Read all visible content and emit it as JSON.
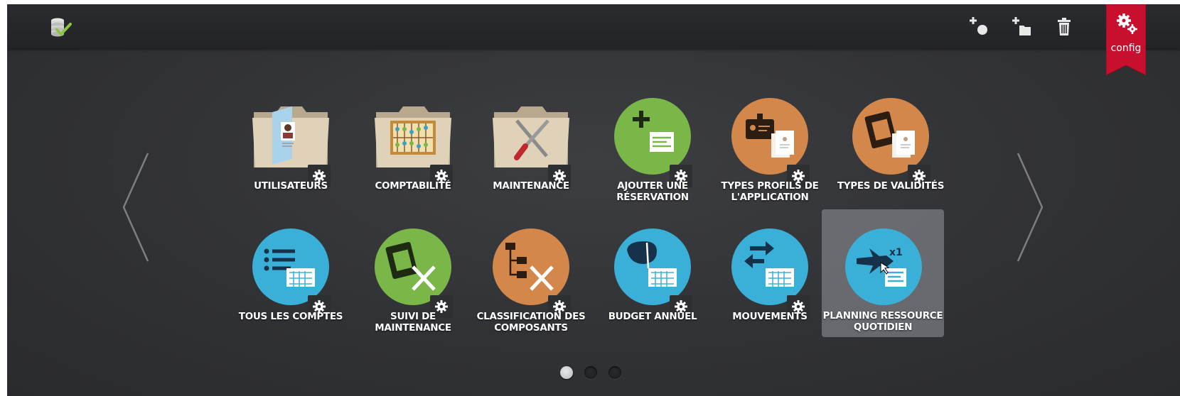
{
  "toolbar": {
    "logo_icon": "database-check-icon",
    "actions": [
      {
        "icon": "add-item-icon"
      },
      {
        "icon": "add-folder-icon"
      },
      {
        "icon": "trash-icon"
      }
    ],
    "config": {
      "label": "config",
      "icon": "gears-icon",
      "color": "#c8102e"
    }
  },
  "tiles": [
    {
      "label": "UTILISATEURS",
      "icon": "folder-users-icon"
    },
    {
      "label": "COMPTABILITÉ",
      "icon": "folder-abacus-icon"
    },
    {
      "label": "MAINTENANCE",
      "icon": "folder-tools-icon"
    },
    {
      "label": "AJOUTER UNE RÉSERVATION",
      "icon": "add-reservation-icon",
      "color": "#7ab648"
    },
    {
      "label": "TYPES PROFILS DE L'APPLICATION",
      "icon": "badge-profiles-icon",
      "color": "#d4874a"
    },
    {
      "label": "TYPES DE VALIDITÉS",
      "icon": "clipboard-validity-icon",
      "color": "#d4874a"
    },
    {
      "label": "TOUS LES COMPTES",
      "icon": "list-accounts-icon",
      "color": "#3ab0d8"
    },
    {
      "label": "SUIVI DE MAINTENANCE",
      "icon": "clipboard-tools-icon",
      "color": "#7ab648"
    },
    {
      "label": "CLASSIFICATION DES COMPOSANTS",
      "icon": "tree-tools-icon",
      "color": "#d4874a"
    },
    {
      "label": "BUDGET ANNUEL",
      "icon": "budget-chart-icon",
      "color": "#3ab0d8"
    },
    {
      "label": "MOUVEMENTS",
      "icon": "movements-arrows-icon",
      "color": "#3ab0d8"
    },
    {
      "label": "PLANNING RESSOURCE QUOTIDIEN",
      "icon": "plane-planning-icon",
      "color": "#3ab0d8",
      "selected": true
    }
  ],
  "pagination": {
    "pages": 3,
    "current": 1
  }
}
